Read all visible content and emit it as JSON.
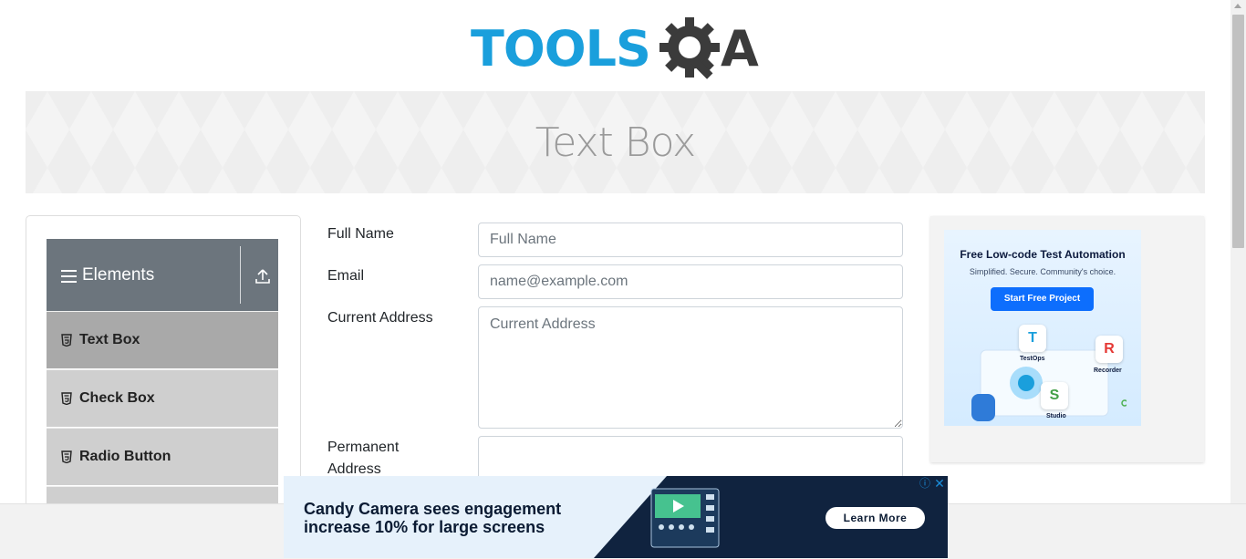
{
  "header": {
    "logo_tools": "TOOLS",
    "logo_a": "A"
  },
  "banner": {
    "title": "Text Box"
  },
  "sidebar": {
    "group_title": "Elements",
    "items": [
      {
        "label": "Text Box"
      },
      {
        "label": "Check Box"
      },
      {
        "label": "Radio Button"
      }
    ]
  },
  "form": {
    "full_name": {
      "label": "Full Name",
      "placeholder": "Full Name"
    },
    "email": {
      "label": "Email",
      "placeholder": "name@example.com"
    },
    "current_address": {
      "label": "Current Address",
      "placeholder": "Current Address"
    },
    "permanent_address": {
      "label": "Permanent Address"
    }
  },
  "right_ad": {
    "headline": "Free Low-code Test Automation",
    "subtitle": "Simplified. Secure. Community's choice.",
    "button": "Start Free Project",
    "badges": [
      {
        "letter": "T",
        "label": "TestOps"
      },
      {
        "letter": "R",
        "label": "Recorder"
      },
      {
        "letter": "S",
        "label": "Studio"
      }
    ]
  },
  "bottom_ad": {
    "headline": "Candy Camera sees engagement increase 10% for large screens",
    "button": "Learn More",
    "info": "ⓘ",
    "close": "✕"
  },
  "colors": {
    "logo_blue": "#1a9fdc",
    "logo_dark": "#3b3b3b",
    "group_header": "#6c757d",
    "menu_item": "#cfcfcf",
    "menu_item_active": "#a9a9a9"
  }
}
